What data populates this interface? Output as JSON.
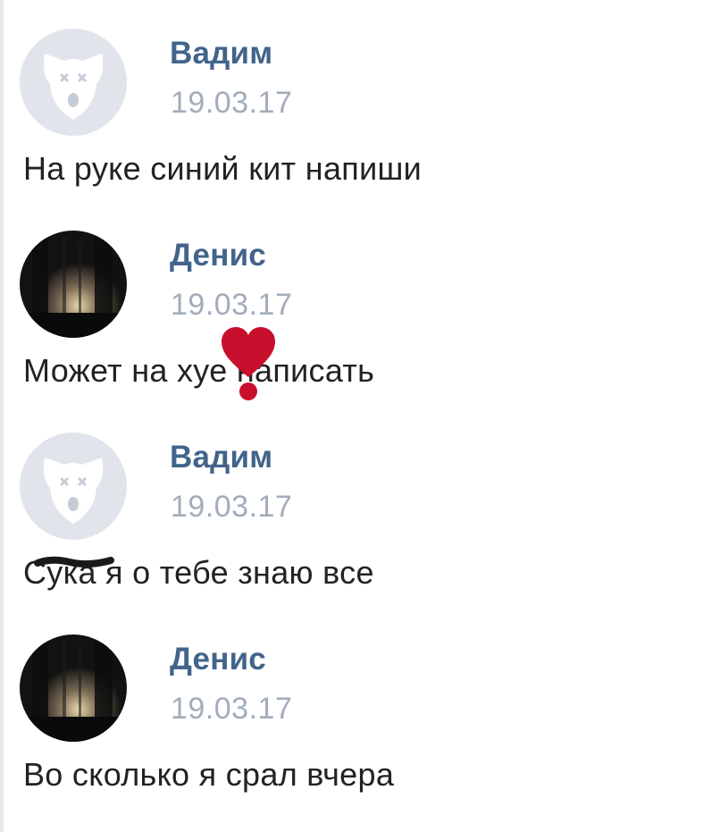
{
  "messages": [
    {
      "author": "Вадим",
      "date": "19.03.17",
      "text": "На руке синий кит напиши",
      "avatar_icon": "vk-default-dog-avatar-icon"
    },
    {
      "author": "Денис",
      "date": "19.03.17",
      "text": "Может на хуе написать",
      "avatar_icon": "dark-photo-avatar-icon"
    },
    {
      "author": "Вадим",
      "date": "19.03.17",
      "text": "Сука я о тебе знаю все",
      "avatar_icon": "vk-default-dog-avatar-icon"
    },
    {
      "author": "Денис",
      "date": "19.03.17",
      "text": "Во сколько я срал вчера",
      "avatar_icon": "dark-photo-avatar-icon"
    }
  ],
  "colors": {
    "author_name": "#42648b",
    "date": "#a3adba",
    "message_text": "#222222",
    "censor_heart": "#c8102e",
    "censor_scribble": "#1a1a1a"
  }
}
